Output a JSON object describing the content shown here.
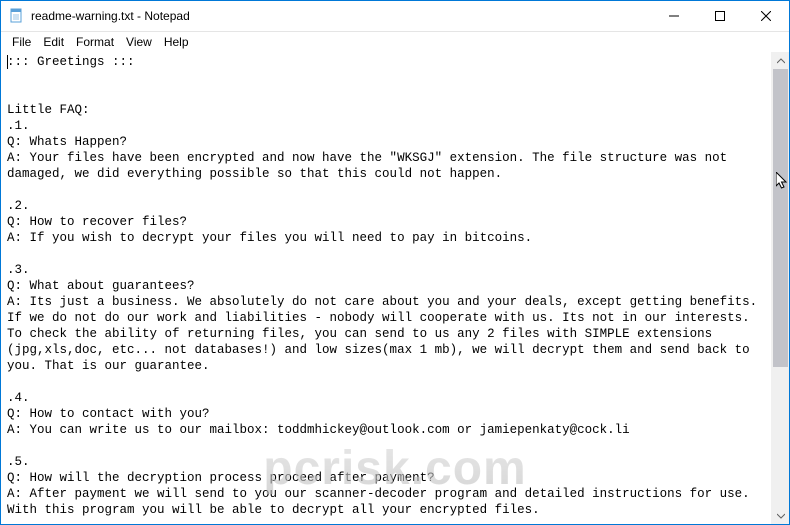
{
  "titlebar": {
    "title": "readme-warning.txt - Notepad"
  },
  "menu": {
    "file": "File",
    "edit": "Edit",
    "format": "Format",
    "view": "View",
    "help": "Help"
  },
  "content": {
    "text": "::: Greetings :::\n\n\nLittle FAQ:\n.1.\nQ: Whats Happen?\nA: Your files have been encrypted and now have the \"WKSGJ\" extension. The file structure was not damaged, we did everything possible so that this could not happen.\n\n.2.\nQ: How to recover files?\nA: If you wish to decrypt your files you will need to pay in bitcoins.\n\n.3.\nQ: What about guarantees?\nA: Its just a business. We absolutely do not care about you and your deals, except getting benefits. If we do not do our work and liabilities - nobody will cooperate with us. Its not in our interests. To check the ability of returning files, you can send to us any 2 files with SIMPLE extensions (jpg,xls,doc, etc... not databases!) and low sizes(max 1 mb), we will decrypt them and send back to you. That is our guarantee.\n\n.4.\nQ: How to contact with you?\nA: You can write us to our mailbox: toddmhickey@outlook.com or jamiepenkaty@cock.li\n\n.5.\nQ: How will the decryption process proceed after payment?\nA: After payment we will send to you our scanner-decoder program and detailed instructions for use. With this program you will be able to decrypt all your encrypted files."
  },
  "watermark": {
    "text": "pcrisk.com"
  }
}
